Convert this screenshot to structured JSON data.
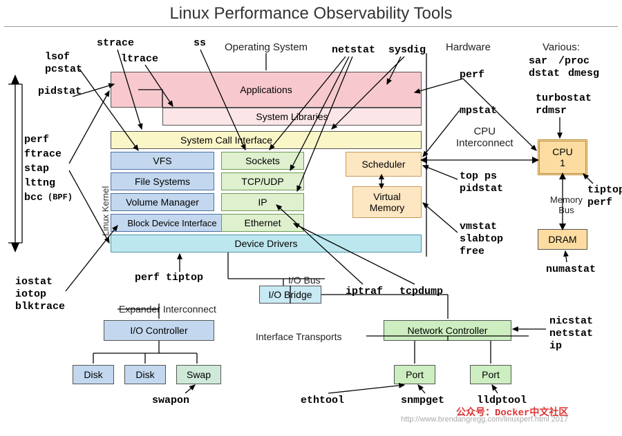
{
  "title": "Linux Performance Observability Tools",
  "sections": {
    "os": "Operating System",
    "hw": "Hardware",
    "various": "Various:",
    "expander": "Expander Interconnect",
    "iface": "Interface Transports",
    "cpuic": "CPU\nInterconnect",
    "membus": "Memory\nBus",
    "iobus": "I/O Bus",
    "kernel": "Linux Kernel"
  },
  "boxes": {
    "apps": "Applications",
    "syslib": "System Libraries",
    "sci": "System Call Interface",
    "vfs": "VFS",
    "fs": "File Systems",
    "vm": "Volume Manager",
    "bdi": "Block Device Interface",
    "sock": "Sockets",
    "tcp": "TCP/UDP",
    "ip": "IP",
    "eth": "Ethernet",
    "sched": "Scheduler",
    "vmem": "Virtual\nMemory",
    "dd": "Device Drivers",
    "iob": "I/O Bridge",
    "ioctrl": "I/O Controller",
    "netctrl": "Network Controller",
    "disk1": "Disk",
    "disk2": "Disk",
    "swap": "Swap",
    "port1": "Port",
    "port2": "Port",
    "cpu": "CPU\n1",
    "dram": "DRAM"
  },
  "tools": {
    "strace": "strace",
    "ss": "ss",
    "lsof": "lsof",
    "pcstat": "pcstat",
    "ltrace": "ltrace",
    "pidstat": "pidstat",
    "perf_group": "perf\nftrace\nstap\nlttng\nbcc",
    "bpf": "(BPF)",
    "iostat": "iostat",
    "iotop": "iotop",
    "blktrace": "blktrace",
    "perf_tiptop": "perf tiptop",
    "swapon": "swapon",
    "netstat": "netstat",
    "sysdig": "sysdig",
    "perf": "perf",
    "mpstat": "mpstat",
    "top_ps": "top ps",
    "pidstat2": "pidstat",
    "vmstat": "vmstat",
    "slabtop": "slabtop",
    "free": "free",
    "iptraf": "iptraf",
    "tcpdump": "tcpdump",
    "ethtool": "ethtool",
    "snmpget": "snmpget",
    "lldptool": "lldptool",
    "sar": "sar",
    "proc": "/proc",
    "dstat": "dstat",
    "dmesg": "dmesg",
    "turbostat": "turbostat",
    "rdmsr": "rdmsr",
    "tiptop": "tiptop",
    "perf2": "perf",
    "numastat": "numastat",
    "nicstat": "nicstat",
    "netstat2": "netstat",
    "ip2": "ip"
  },
  "credit": "http://www.brendangregg.com/linuxperf.html 2017",
  "watermark": "公众号：Docker中文社区"
}
